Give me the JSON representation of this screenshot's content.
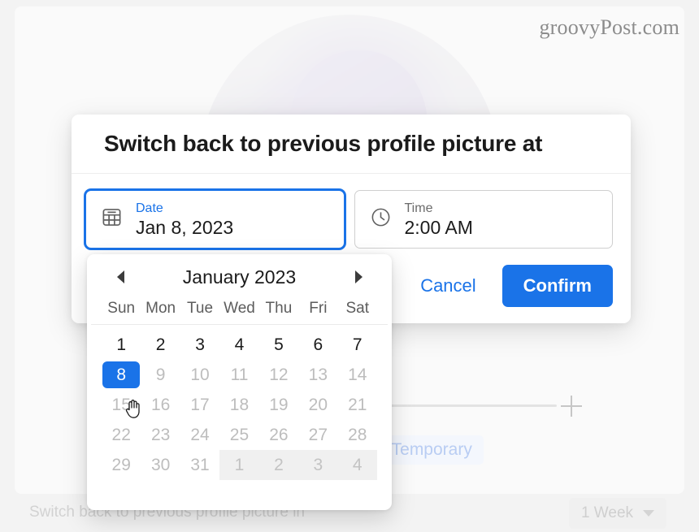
{
  "watermark": "groovyPost.com",
  "background": {
    "avatar_alt": "profile-picture-football-player",
    "make_temporary_label": "ke Temporary",
    "switch_back_label": "Switch back to previous profile picture in",
    "duration_value": "1 Week",
    "add_icon": "plus-icon"
  },
  "dialog": {
    "title": "Switch back to previous profile picture at",
    "date_field": {
      "label": "Date",
      "value": "Jan 8, 2023",
      "icon": "calendar-icon",
      "focused": true
    },
    "time_field": {
      "label": "Time",
      "value": "2:00 AM",
      "icon": "clock-icon",
      "focused": false
    },
    "cancel_label": "Cancel",
    "confirm_label": "Confirm"
  },
  "calendar": {
    "month_label": "January 2023",
    "prev_icon": "chevron-left-icon",
    "next_icon": "chevron-right-icon",
    "weekdays": [
      "Sun",
      "Mon",
      "Tue",
      "Wed",
      "Thu",
      "Fri",
      "Sat"
    ],
    "selected_day": 8,
    "cells": [
      {
        "d": "1",
        "state": "enabled"
      },
      {
        "d": "2",
        "state": "enabled"
      },
      {
        "d": "3",
        "state": "enabled"
      },
      {
        "d": "4",
        "state": "enabled"
      },
      {
        "d": "5",
        "state": "enabled"
      },
      {
        "d": "6",
        "state": "enabled"
      },
      {
        "d": "7",
        "state": "enabled"
      },
      {
        "d": "8",
        "state": "selected"
      },
      {
        "d": "9",
        "state": "dim"
      },
      {
        "d": "10",
        "state": "dim"
      },
      {
        "d": "11",
        "state": "dim"
      },
      {
        "d": "12",
        "state": "dim"
      },
      {
        "d": "13",
        "state": "dim"
      },
      {
        "d": "14",
        "state": "dim"
      },
      {
        "d": "15",
        "state": "dim"
      },
      {
        "d": "16",
        "state": "dim"
      },
      {
        "d": "17",
        "state": "dim"
      },
      {
        "d": "18",
        "state": "dim"
      },
      {
        "d": "19",
        "state": "dim"
      },
      {
        "d": "20",
        "state": "dim"
      },
      {
        "d": "21",
        "state": "dim"
      },
      {
        "d": "22",
        "state": "dim"
      },
      {
        "d": "23",
        "state": "dim"
      },
      {
        "d": "24",
        "state": "dim"
      },
      {
        "d": "25",
        "state": "dim"
      },
      {
        "d": "26",
        "state": "dim"
      },
      {
        "d": "27",
        "state": "dim"
      },
      {
        "d": "28",
        "state": "dim"
      },
      {
        "d": "29",
        "state": "dim"
      },
      {
        "d": "30",
        "state": "dim"
      },
      {
        "d": "31",
        "state": "dim"
      },
      {
        "d": "1",
        "state": "other-month"
      },
      {
        "d": "2",
        "state": "other-month"
      },
      {
        "d": "3",
        "state": "other-month"
      },
      {
        "d": "4",
        "state": "other-month"
      }
    ]
  },
  "colors": {
    "accent": "#1a73e8",
    "page_bg": "#f3f3f3",
    "dialog_bg": "#ffffff",
    "text_primary": "#1b1b1b",
    "text_dim": "#bdbdbd"
  }
}
